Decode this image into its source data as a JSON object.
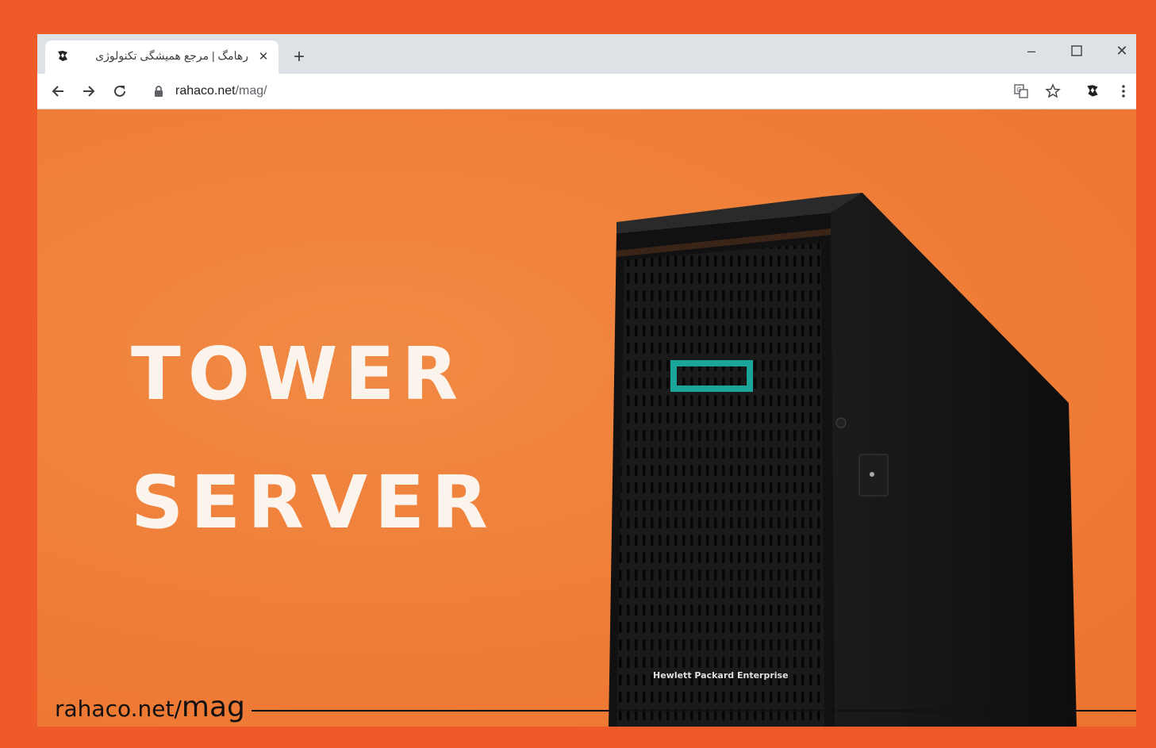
{
  "browser": {
    "tab": {
      "title": "رهامگ | مرجع همیشگی تکنولوژی",
      "close_label": "✕"
    },
    "new_tab_label": "+",
    "window_controls": {
      "minimize": "–",
      "maximize": "☐",
      "close": "✕"
    },
    "nav": {
      "back_icon": "arrow-left-icon",
      "forward_icon": "arrow-right-icon",
      "reload_icon": "reload-icon"
    },
    "address": {
      "host": "rahaco.net",
      "path": "/mag/"
    },
    "toolbar_icons": [
      "translate-icon",
      "star-icon",
      "extension-icon",
      "menu-icon"
    ]
  },
  "page": {
    "headline_line1": "TOWER",
    "headline_line2": "SERVER",
    "server_brand": "Hewlett Packard Enterprise",
    "watermark_host": "rahaco.net/",
    "watermark_path": "mag"
  },
  "colors": {
    "frame": "#ee5a28",
    "background": "#ef7e38",
    "accent_logo": "#1aa59a",
    "server_body": "#151515"
  }
}
